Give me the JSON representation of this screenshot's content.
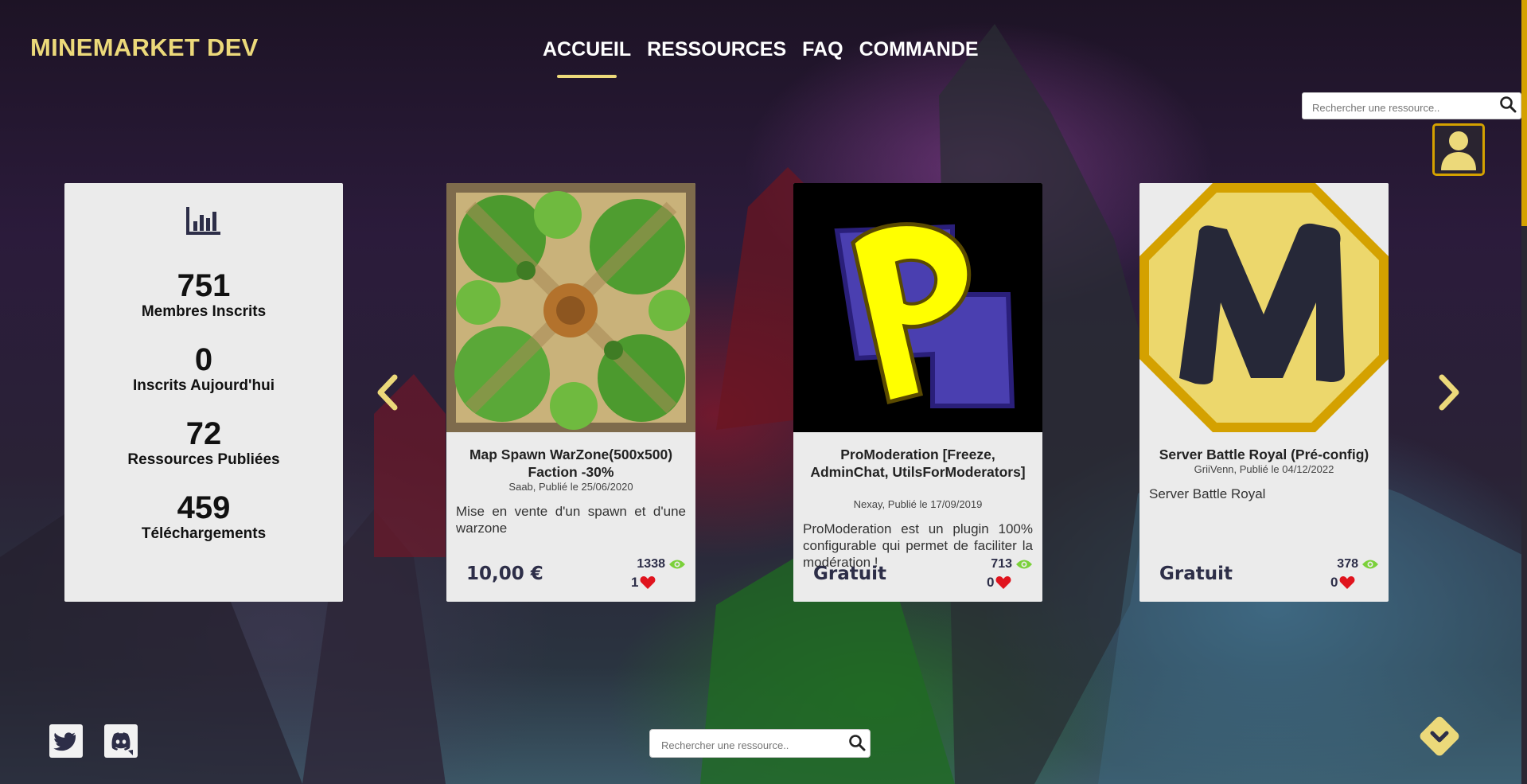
{
  "brand": {
    "name": "MINEMARKET DEV"
  },
  "nav": {
    "items": [
      {
        "label": "ACCUEIL"
      },
      {
        "label": "RESSOURCES"
      },
      {
        "label": "FAQ"
      },
      {
        "label": "COMMANDE"
      }
    ],
    "active": "ACCUEIL"
  },
  "search": {
    "placeholder": "Rechercher une ressource.."
  },
  "stats": {
    "icon": "bar-chart-icon",
    "items": [
      {
        "value": "751",
        "label": "Membres Inscrits"
      },
      {
        "value": "0",
        "label": "Inscrits Aujourd'hui"
      },
      {
        "value": "72",
        "label": "Ressources Publiées"
      },
      {
        "value": "459",
        "label": "Téléchargements"
      }
    ]
  },
  "carousel": {
    "prev_icon": "chevron-left-icon",
    "next_icon": "chevron-right-icon",
    "cards": [
      {
        "title": "Map Spawn WarZone(500x500) Faction -30%",
        "meta": "Saab, Publié le 25/06/2020",
        "description": "Mise en vente d'un spawn et d'une warzone",
        "price": "10,00 €",
        "views": "1338",
        "likes": "1"
      },
      {
        "title": "ProModeration [Freeze, AdminChat, UtilsForModerators]",
        "meta": "Nexay, Publié le 17/09/2019",
        "description": "ProModeration est un plugin 100% configurable qui permet de faciliter la modération !",
        "price": "Gratuit",
        "views": "713",
        "likes": "0"
      },
      {
        "title": "Server Battle Royal (Pré-config)",
        "meta": "GriiVenn, Publié le 04/12/2022",
        "description": "Server Battle Royal",
        "price": "Gratuit",
        "views": "378",
        "likes": "0"
      }
    ]
  },
  "colors": {
    "accent": "#ecd97a",
    "gold": "#d4a100",
    "card_bg": "#ebebeb",
    "eye": "#7bd13a",
    "heart": "#e0141e",
    "text_dark": "#2d2e48"
  },
  "footer": {
    "social": [
      "twitter-icon",
      "discord-icon"
    ],
    "scroll_icon": "chevron-down-icon"
  }
}
